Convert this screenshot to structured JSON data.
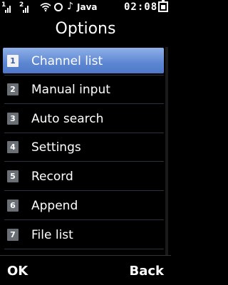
{
  "status_bar": {
    "sim1_label": "1",
    "sim2_label": "2",
    "app_label": "Java",
    "time": "02:08",
    "icons": [
      "signal-icon",
      "signal-icon",
      "wifi-icon",
      "music-note-icon",
      "battery-icon"
    ]
  },
  "screen": {
    "title": "Options"
  },
  "menu": {
    "items": [
      {
        "number": "1",
        "label": "Channel list"
      },
      {
        "number": "2",
        "label": "Manual input"
      },
      {
        "number": "3",
        "label": "Auto search"
      },
      {
        "number": "4",
        "label": "Settings"
      },
      {
        "number": "5",
        "label": "Record"
      },
      {
        "number": "6",
        "label": "Append"
      },
      {
        "number": "7",
        "label": "File list"
      }
    ],
    "selected_index": 0
  },
  "softkeys": {
    "left": "OK",
    "right": "Back"
  },
  "colors": {
    "background": "#000000",
    "highlight": "#5d86d2",
    "badge": "#6a6e75",
    "text": "#ffffff"
  }
}
